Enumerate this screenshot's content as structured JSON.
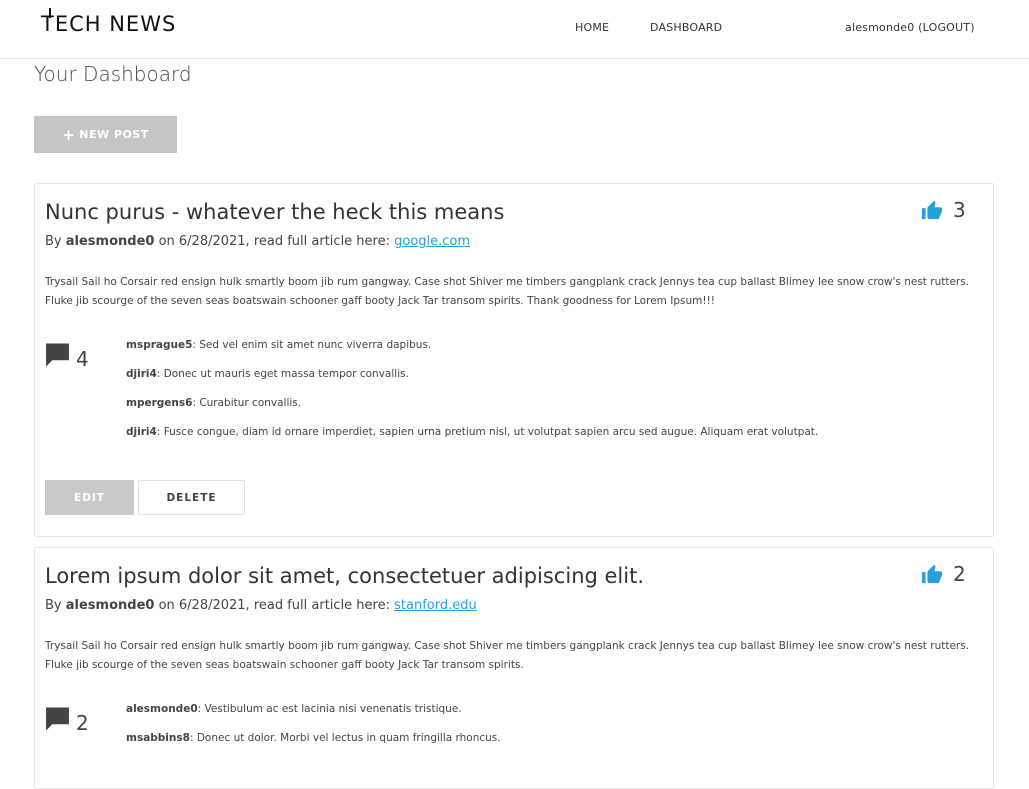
{
  "nav": {
    "logo": "TECH NEWS",
    "home": "HOME",
    "dashboard": "DASHBOARD",
    "user": "alesmonde0 (LOGOUT)"
  },
  "page": {
    "title": "Your Dashboard",
    "new_post_label": "NEW POST"
  },
  "posts": [
    {
      "title": "Nunc purus - whatever the heck this means",
      "by_prefix": "By ",
      "author": "alesmonde0",
      "date_text": " on 6/28/2021, read full article here: ",
      "link": "google.com",
      "likes": "3",
      "body": "Trysail Sail ho Corsair red ensign hulk smartly boom jib rum gangway. Case shot Shiver me timbers gangplank crack Jennys tea cup ballast Blimey lee snow crow's nest rutters. Fluke jib scourge of the seven seas boatswain schooner gaff booty Jack Tar transom spirits. Thank goodness for Lorem Ipsum!!!",
      "comment_count": "4",
      "comments": [
        {
          "user": "msprague5",
          "text": ": Sed vel enim sit amet nunc viverra dapibus."
        },
        {
          "user": "djiri4",
          "text": ": Donec ut mauris eget massa tempor convallis."
        },
        {
          "user": "mpergens6",
          "text": ": Curabitur convallis."
        },
        {
          "user": "djiri4",
          "text": ": Fusce congue, diam id ornare imperdiet, sapien urna pretium nisl, ut volutpat sapien arcu sed augue. Aliquam erat volutpat."
        }
      ],
      "edit_label": "EDIT",
      "delete_label": "DELETE"
    },
    {
      "title": "Lorem ipsum dolor sit amet, consectetuer adipiscing elit.",
      "by_prefix": "By ",
      "author": "alesmonde0",
      "date_text": " on 6/28/2021, read full article here: ",
      "link": "stanford.edu",
      "likes": "2",
      "body": "Trysail Sail ho Corsair red ensign hulk smartly boom jib rum gangway. Case shot Shiver me timbers gangplank crack Jennys tea cup ballast Blimey lee snow crow's nest rutters. Fluke jib scourge of the seven seas boatswain schooner gaff booty Jack Tar transom spirits.",
      "comment_count": "2",
      "comments": [
        {
          "user": "alesmonde0",
          "text": ": Vestibulum ac est lacinia nisi venenatis tristique."
        },
        {
          "user": "msabbins8",
          "text": ": Donec ut dolor. Morbi vel lectus in quam fringilla rhoncus."
        }
      ]
    }
  ],
  "colors": {
    "accent": "#27a0d8",
    "button_gray": "#c5c5c5"
  },
  "icons": {
    "like": "thumbs-up-icon",
    "comment": "comment-bubble-icon",
    "plus": "plus-icon"
  }
}
